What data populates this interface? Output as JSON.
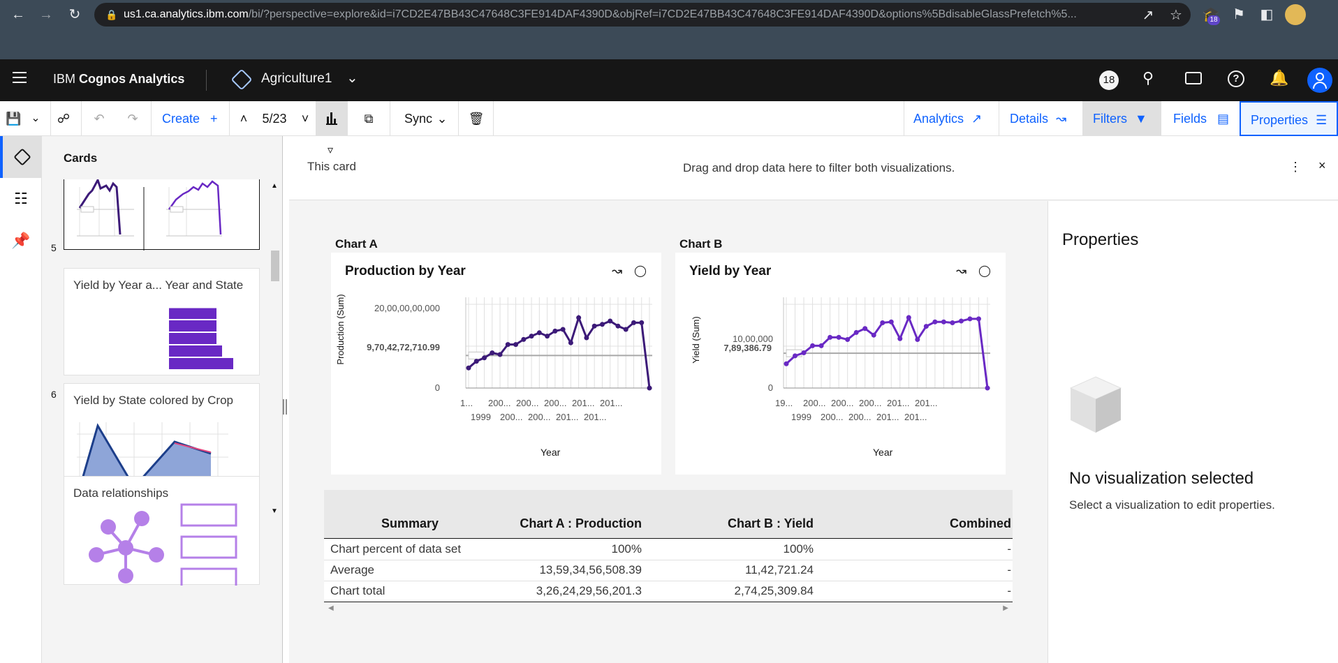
{
  "browser": {
    "url_host": "us1.ca.analytics.ibm.com",
    "url_path": "/bi/?perspective=explore&id=i7CD2E47BB43C47648C3FE914DAF4390D&objRef=i7CD2E47BB43C47648C3FE914DAF4390D&options%5BdisableGlassPrefetch%5...",
    "extension_badge": "18"
  },
  "topbar": {
    "brand_prefix": "IBM ",
    "brand_name": "Cognos Analytics",
    "workspace": "Agriculture1",
    "notification_count": "18"
  },
  "toolbar": {
    "create_label": "Create",
    "page_indicator": "5/23",
    "sync_label": "Sync",
    "tabs": [
      {
        "label": "Analytics"
      },
      {
        "label": "Details"
      },
      {
        "label": "Filters"
      },
      {
        "label": "Fields"
      },
      {
        "label": "Properties"
      }
    ]
  },
  "cards_panel": {
    "title": "Cards",
    "cards": [
      {
        "number": "5",
        "title": ""
      },
      {
        "number": "6",
        "title": "Yield by Year a... Year and State"
      },
      {
        "number": "",
        "title": "Yield by State colored by Crop"
      },
      {
        "number": "",
        "title": "Data relationships"
      }
    ]
  },
  "filter_bar": {
    "scope_label": "This card",
    "drop_hint": "Drag and drop data here to filter both visualizations."
  },
  "charts": [
    {
      "label": "Chart A",
      "title": "Production by Year",
      "ylabel": "Production (Sum)",
      "xlabel": "Year",
      "y_ticks": [
        "20,00,00,00,000",
        "0"
      ],
      "reference_label": "9,70,42,72,710.99",
      "x_ticks_row1": [
        "1...",
        "200...",
        "200...",
        "200...",
        "201...",
        "201..."
      ],
      "x_ticks_row2": [
        "1999",
        "200...",
        "200...",
        "201...",
        "201..."
      ]
    },
    {
      "label": "Chart B",
      "title": "Yield by Year",
      "ylabel": "Yield (Sum)",
      "xlabel": "Year",
      "y_ticks": [
        "10,00,000",
        "0"
      ],
      "reference_label": "7,89,386.79",
      "x_ticks_row1": [
        "19...",
        "200...",
        "200...",
        "200...",
        "201...",
        "201..."
      ],
      "x_ticks_row2": [
        "1999",
        "200...",
        "200...",
        "201...",
        "201..."
      ]
    }
  ],
  "chart_data": [
    {
      "type": "line",
      "title": "Production by Year",
      "xlabel": "Year",
      "ylabel": "Production (Sum)",
      "ylim": [
        0,
        25000000000
      ],
      "reference_line": 9704272710.99,
      "values": [
        6000000000,
        8000000000,
        9000000000,
        10500000000,
        10000000000,
        13000000000,
        13000000000,
        14500000000,
        15500000000,
        16500000000,
        15500000000,
        17000000000,
        17500000000,
        13500000000,
        21000000000,
        15000000000,
        18500000000,
        19000000000,
        20000000000,
        18500000000,
        17500000000,
        19500000000,
        19500000000,
        0
      ],
      "color": "#3c1a78"
    },
    {
      "type": "line",
      "title": "Yield by Year",
      "xlabel": "Year",
      "ylabel": "Yield (Sum)",
      "ylim": [
        0,
        1900000
      ],
      "reference_line": 789386.79,
      "values": [
        550000,
        730000,
        800000,
        960000,
        960000,
        1150000,
        1150000,
        1100000,
        1260000,
        1350000,
        1200000,
        1480000,
        1500000,
        1120000,
        1600000,
        1100000,
        1400000,
        1500000,
        1500000,
        1480000,
        1520000,
        1570000,
        1570000,
        0
      ],
      "color": "#6929c4"
    }
  ],
  "summary": {
    "headers": [
      "Summary",
      "Chart A : Production",
      "Chart B : Yield",
      "Combined"
    ],
    "rows": [
      {
        "label": "Chart percent of data set",
        "a": "100%",
        "b": "100%",
        "c": "-"
      },
      {
        "label": "Average",
        "a": "13,59,34,56,508.39",
        "b": "11,42,721.24",
        "c": "-"
      },
      {
        "label": "Chart total",
        "a": "3,26,24,29,56,201.3",
        "b": "2,74,25,309.84",
        "c": "-"
      }
    ]
  },
  "properties_panel": {
    "title": "Properties",
    "empty_title": "No visualization selected",
    "empty_text": "Select a visualization to edit properties."
  },
  "colors": {
    "accent": "#0f62fe",
    "purple": "#6929c4",
    "dark_purple": "#3c1a78"
  }
}
